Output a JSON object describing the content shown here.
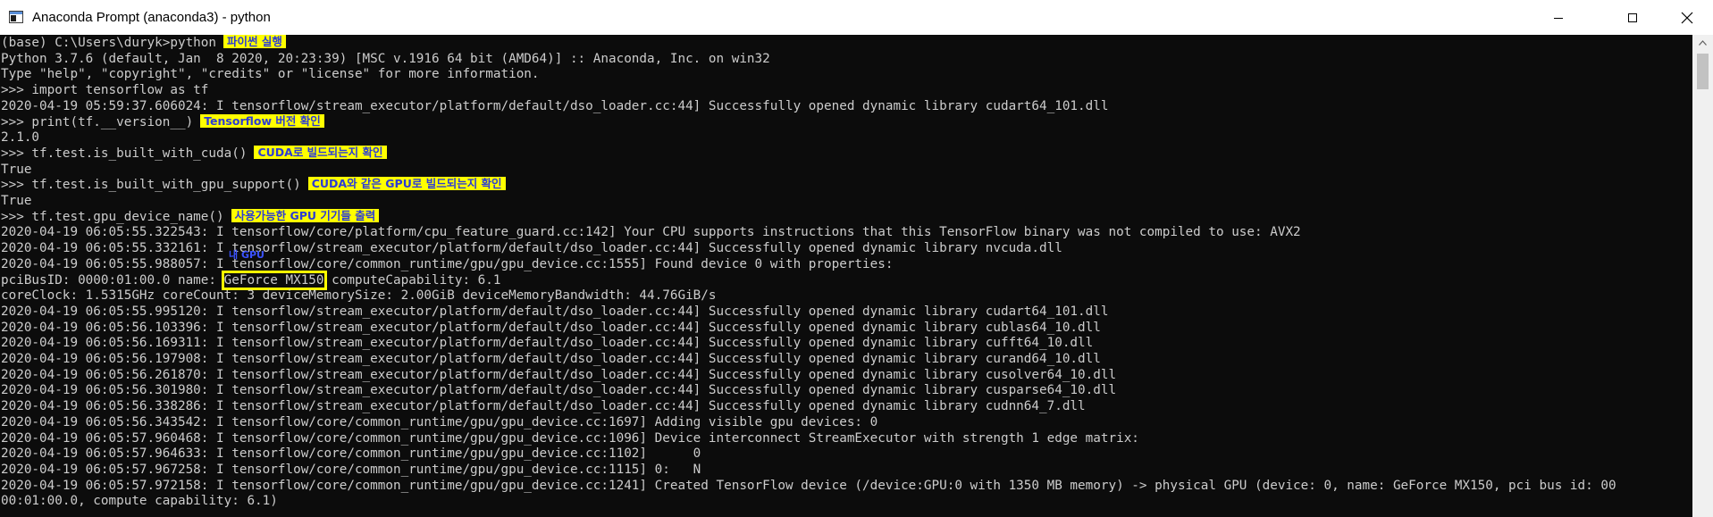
{
  "window": {
    "title": "Anaconda Prompt (anaconda3) - python",
    "controls": {
      "minimize": "minimize-icon",
      "maximize": "maximize-icon",
      "close": "close-icon"
    }
  },
  "console": {
    "lines": [
      {
        "text": "(base) C:\\Users\\duryk>python",
        "annotation": "파이썬 실행"
      },
      {
        "text": "Python 3.7.6 (default, Jan  8 2020, 20:23:39) [MSC v.1916 64 bit (AMD64)] :: Anaconda, Inc. on win32"
      },
      {
        "text": "Type \"help\", \"copyright\", \"credits\" or \"license\" for more information."
      },
      {
        "text": ">>> import tensorflow as tf"
      },
      {
        "text": "2020-04-19 05:59:37.606024: I tensorflow/stream_executor/platform/default/dso_loader.cc:44] Successfully opened dynamic library cudart64_101.dll"
      },
      {
        "text": ">>> print(tf.__version__)",
        "annotation": "Tensorflow 버전 확인"
      },
      {
        "text": "2.1.0"
      },
      {
        "text": ">>> tf.test.is_built_with_cuda()",
        "annotation": "CUDA로 빌드되는지 확인"
      },
      {
        "text": "True"
      },
      {
        "text": ">>> tf.test.is_built_with_gpu_support()",
        "annotation": "CUDA와 같은 GPU로 빌드되는지 확인"
      },
      {
        "text": "True"
      },
      {
        "text": ">>> tf.test.gpu_device_name()",
        "annotation": "사용가능한 GPU 기기들 출력"
      },
      {
        "text": "2020-04-19 06:05:55.322543: I tensorflow/core/platform/cpu_feature_guard.cc:142] Your CPU supports instructions that this TensorFlow binary was not compiled to use: AVX2"
      },
      {
        "text": "2020-04-19 06:05:55.332161: I tensorflow/stream_executor/platform/default/dso_loader.cc:44] Successfully opened dynamic library nvcuda.dll"
      },
      {
        "text": "2020-04-19 06:05:55.988057: I tensorflow/core/common_runtime/gpu/gpu_device.cc:1555] Found device 0 with properties:"
      },
      {
        "text_before": "pciBusID: 0000:01:00.0 name: ",
        "boxed": "GeForce MX150",
        "text_after": " computeCapability: 6.1",
        "box_note": "내 GPU"
      },
      {
        "text": "coreClock: 1.5315GHz coreCount: 3 deviceMemorySize: 2.00GiB deviceMemoryBandwidth: 44.76GiB/s"
      },
      {
        "text": "2020-04-19 06:05:55.995120: I tensorflow/stream_executor/platform/default/dso_loader.cc:44] Successfully opened dynamic library cudart64_101.dll"
      },
      {
        "text": "2020-04-19 06:05:56.103396: I tensorflow/stream_executor/platform/default/dso_loader.cc:44] Successfully opened dynamic library cublas64_10.dll"
      },
      {
        "text": "2020-04-19 06:05:56.169311: I tensorflow/stream_executor/platform/default/dso_loader.cc:44] Successfully opened dynamic library cufft64_10.dll"
      },
      {
        "text": "2020-04-19 06:05:56.197908: I tensorflow/stream_executor/platform/default/dso_loader.cc:44] Successfully opened dynamic library curand64_10.dll"
      },
      {
        "text": "2020-04-19 06:05:56.261870: I tensorflow/stream_executor/platform/default/dso_loader.cc:44] Successfully opened dynamic library cusolver64_10.dll"
      },
      {
        "text": "2020-04-19 06:05:56.301980: I tensorflow/stream_executor/platform/default/dso_loader.cc:44] Successfully opened dynamic library cusparse64_10.dll"
      },
      {
        "text": "2020-04-19 06:05:56.338286: I tensorflow/stream_executor/platform/default/dso_loader.cc:44] Successfully opened dynamic library cudnn64_7.dll"
      },
      {
        "text": "2020-04-19 06:05:56.343542: I tensorflow/core/common_runtime/gpu/gpu_device.cc:1697] Adding visible gpu devices: 0"
      },
      {
        "text": "2020-04-19 06:05:57.960468: I tensorflow/core/common_runtime/gpu/gpu_device.cc:1096] Device interconnect StreamExecutor with strength 1 edge matrix:"
      },
      {
        "text": "2020-04-19 06:05:57.964633: I tensorflow/core/common_runtime/gpu/gpu_device.cc:1102]      0"
      },
      {
        "text": "2020-04-19 06:05:57.967258: I tensorflow/core/common_runtime/gpu/gpu_device.cc:1115] 0:   N"
      },
      {
        "text": "2020-04-19 06:05:57.972158: I tensorflow/core/common_runtime/gpu/gpu_device.cc:1241] Created TensorFlow device (/device:GPU:0 with 1350 MB memory) -> physical GPU (device: 0, name: GeForce MX150, pci bus id: 00"
      },
      {
        "text": "00:01:00.0, compute capability: 6.1)"
      }
    ]
  },
  "colors": {
    "background": "#0c0c0c",
    "text": "#cccccc",
    "annotation_bg": "#ffff00",
    "annotation_text": "#2b3bd6"
  }
}
